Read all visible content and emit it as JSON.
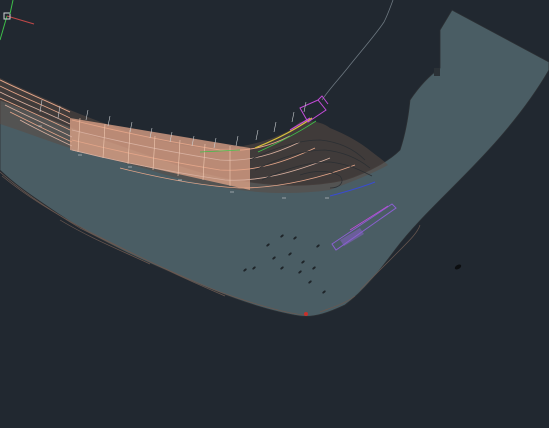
{
  "app": {
    "view": "cad-model-space",
    "background_color": "#212830"
  },
  "colors": {
    "water": "#4a5d64",
    "contour_orange": "#e3a589",
    "contour_light": "#d8b0a0",
    "line_dark": "#2b2f33",
    "magenta": "#c34bd8",
    "purple_outline": "#8a5fd0",
    "yellow": "#d8c23a",
    "green": "#3fbf4a",
    "red_marker": "#c8302a",
    "blue": "#3a4cd0",
    "white_ticks": "#cfd3d6",
    "ucs_x": "#c04848",
    "ucs_y": "#3fbf4a"
  },
  "icons": {
    "ucs": "ucs-axis-icon"
  }
}
